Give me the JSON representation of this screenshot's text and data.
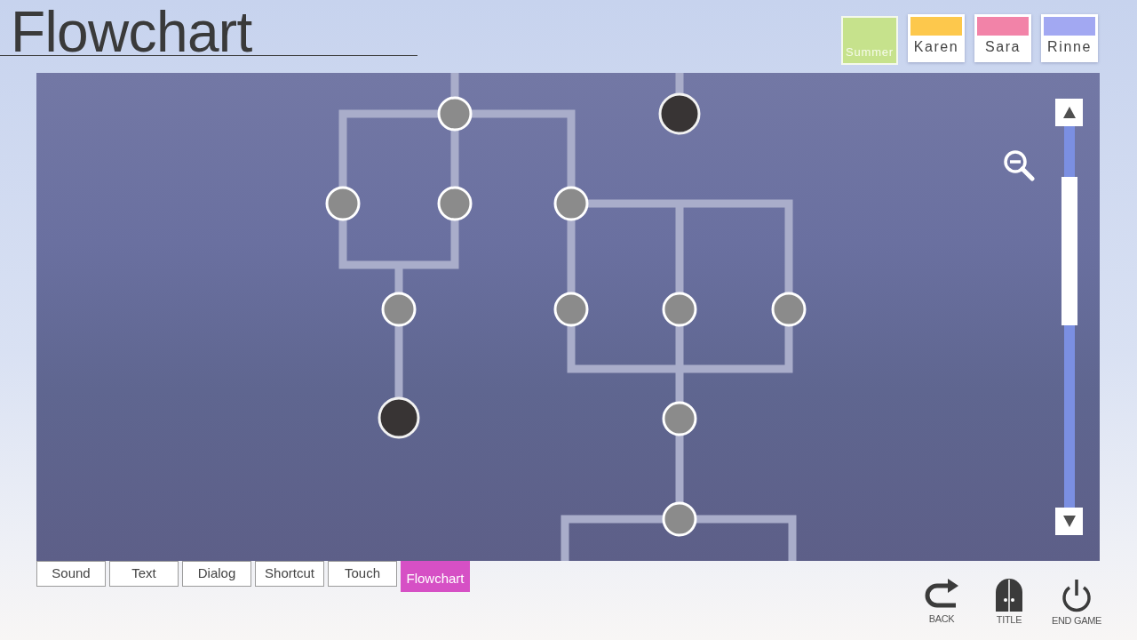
{
  "title": "Flowchart",
  "routes": [
    {
      "label": "Summer",
      "color": "#c6e28c",
      "selected": true
    },
    {
      "label": "Karen",
      "color": "#fdc84c",
      "selected": false
    },
    {
      "label": "Sara",
      "color": "#f283a8",
      "selected": false
    },
    {
      "label": "Rinne",
      "color": "#a2a8f2",
      "selected": false
    }
  ],
  "flowchart": {
    "nodes": [
      {
        "kind": "plain"
      },
      {
        "kind": "dark"
      },
      {
        "kind": "plain"
      },
      {
        "kind": "plain"
      },
      {
        "kind": "plain"
      },
      {
        "kind": "plain"
      },
      {
        "kind": "plain"
      },
      {
        "kind": "plain"
      },
      {
        "kind": "plain"
      },
      {
        "kind": "dark"
      },
      {
        "kind": "plain"
      },
      {
        "kind": "plain"
      }
    ]
  },
  "settings_tabs": [
    {
      "label": "Sound",
      "selected": false
    },
    {
      "label": "Text",
      "selected": false
    },
    {
      "label": "Dialog",
      "selected": false
    },
    {
      "label": "Shortcut",
      "selected": false
    },
    {
      "label": "Touch",
      "selected": false
    },
    {
      "label": "Flowchart",
      "selected": true
    }
  ],
  "actions": [
    {
      "label": "BACK",
      "kind": "back"
    },
    {
      "label": "TITLE",
      "kind": "title"
    },
    {
      "label": "END GAME",
      "kind": "power"
    }
  ]
}
